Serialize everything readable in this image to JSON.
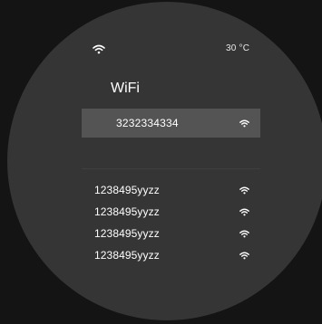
{
  "status_bar": {
    "wifi_icon": "wifi-icon",
    "temperature": "30 °C"
  },
  "header": {
    "title": "WiFi"
  },
  "connected_network": {
    "name": "3232334334",
    "signal_icon": "wifi-icon",
    "highlight_color": "#545454"
  },
  "available_networks": [
    {
      "name": "1238495yyzz",
      "signal_icon": "wifi-icon"
    },
    {
      "name": "1238495yyzz",
      "signal_icon": "wifi-icon"
    },
    {
      "name": "1238495yyzz",
      "signal_icon": "wifi-icon"
    },
    {
      "name": "1238495yyzz",
      "signal_icon": "wifi-icon"
    }
  ],
  "colors": {
    "screen_background": "#353535",
    "outer_background": "#141414",
    "text": "#ffffff"
  }
}
